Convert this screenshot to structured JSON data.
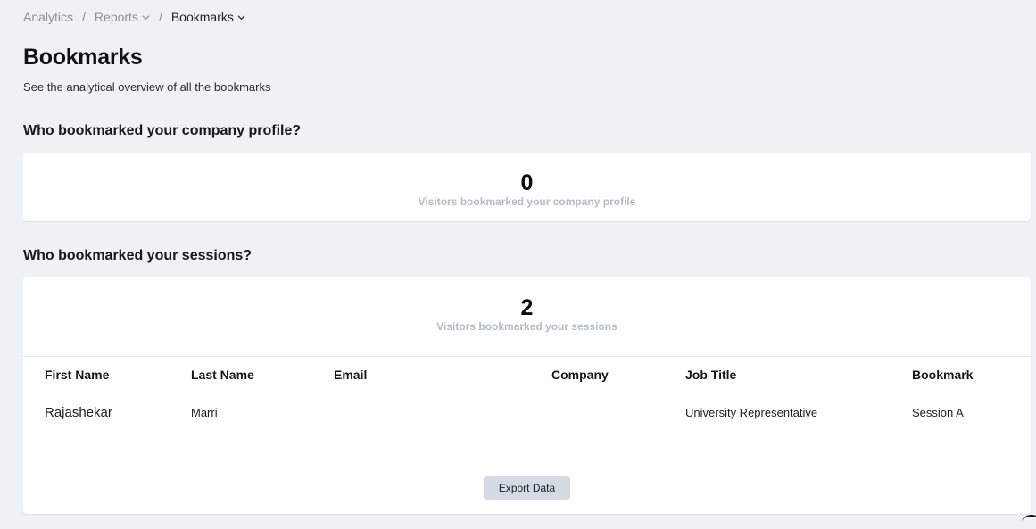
{
  "breadcrumb": {
    "items": [
      {
        "label": "Analytics"
      },
      {
        "label": "Reports"
      },
      {
        "label": "Bookmarks"
      }
    ],
    "separator": "/"
  },
  "header": {
    "title": "Bookmarks",
    "subtitle": "See the analytical overview of all the bookmarks"
  },
  "company_section": {
    "heading": "Who bookmarked your company profile?",
    "count": "0",
    "caption": "Visitors bookmarked your company profile"
  },
  "sessions_section": {
    "heading": "Who bookmarked your sessions?",
    "count": "2",
    "caption": "Visitors bookmarked your sessions",
    "columns": [
      "First Name",
      "Last Name",
      "Email",
      "Company",
      "Job Title",
      "Bookmark"
    ],
    "rows": [
      {
        "first_name": "Rajashekar",
        "last_name": "Marri",
        "email": "",
        "company": "",
        "job_title": "University Representative",
        "bookmark": "Session A"
      }
    ],
    "export_label": "Export Data"
  },
  "colors": {
    "background": "#f0f1f5",
    "card": "#ffffff",
    "caption": "#b3bccb",
    "button": "#d5dbe5"
  }
}
